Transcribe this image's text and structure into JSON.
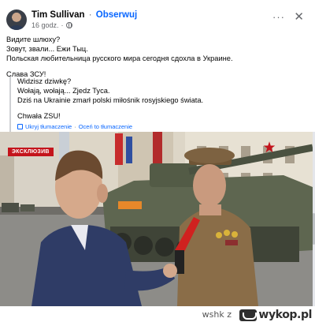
{
  "post": {
    "author": "Tim Sullivan",
    "separator": "·",
    "follow_label": "Obserwuj",
    "timestamp": "16 godz.",
    "meta_separator": "·",
    "audience_icon": "globe-icon",
    "more_icon": "more-horizontal-icon",
    "more_label": "···",
    "close_icon": "close-icon",
    "close_label": "✕",
    "original_text": [
      "Видите шлюху?",
      "Зовут, звали... Ежи Тыц.",
      "Польская любительница русского мира сегодня сдохла в Украине."
    ],
    "original_slogan": "Слава ЗСУ!",
    "translated_text": [
      "Widzisz dziwkę?",
      "Wołają, wołają... Zjedz Tyca.",
      "Dziś na Ukrainie zmarł polski miłośnik rosyjskiego świata."
    ],
    "translated_slogan": "Chwała ZSU!",
    "hide_translation_label": "Ukryj tłumaczenie",
    "rate_translation_label": "Oceń to tłumaczenie",
    "translation_separator": "·",
    "translation_icon": "translate-icon"
  },
  "video": {
    "badge": "ЭКСКЛЮЗИВ",
    "channel_icon": "zvezda-star-icon",
    "channel_glyph": "★"
  },
  "footer": {
    "username": "wshk z",
    "site_logo": "wykop.pl"
  },
  "colors": {
    "accent_blue": "#0866ff",
    "badge_red": "#c4141c",
    "muted_text": "#65676b"
  }
}
